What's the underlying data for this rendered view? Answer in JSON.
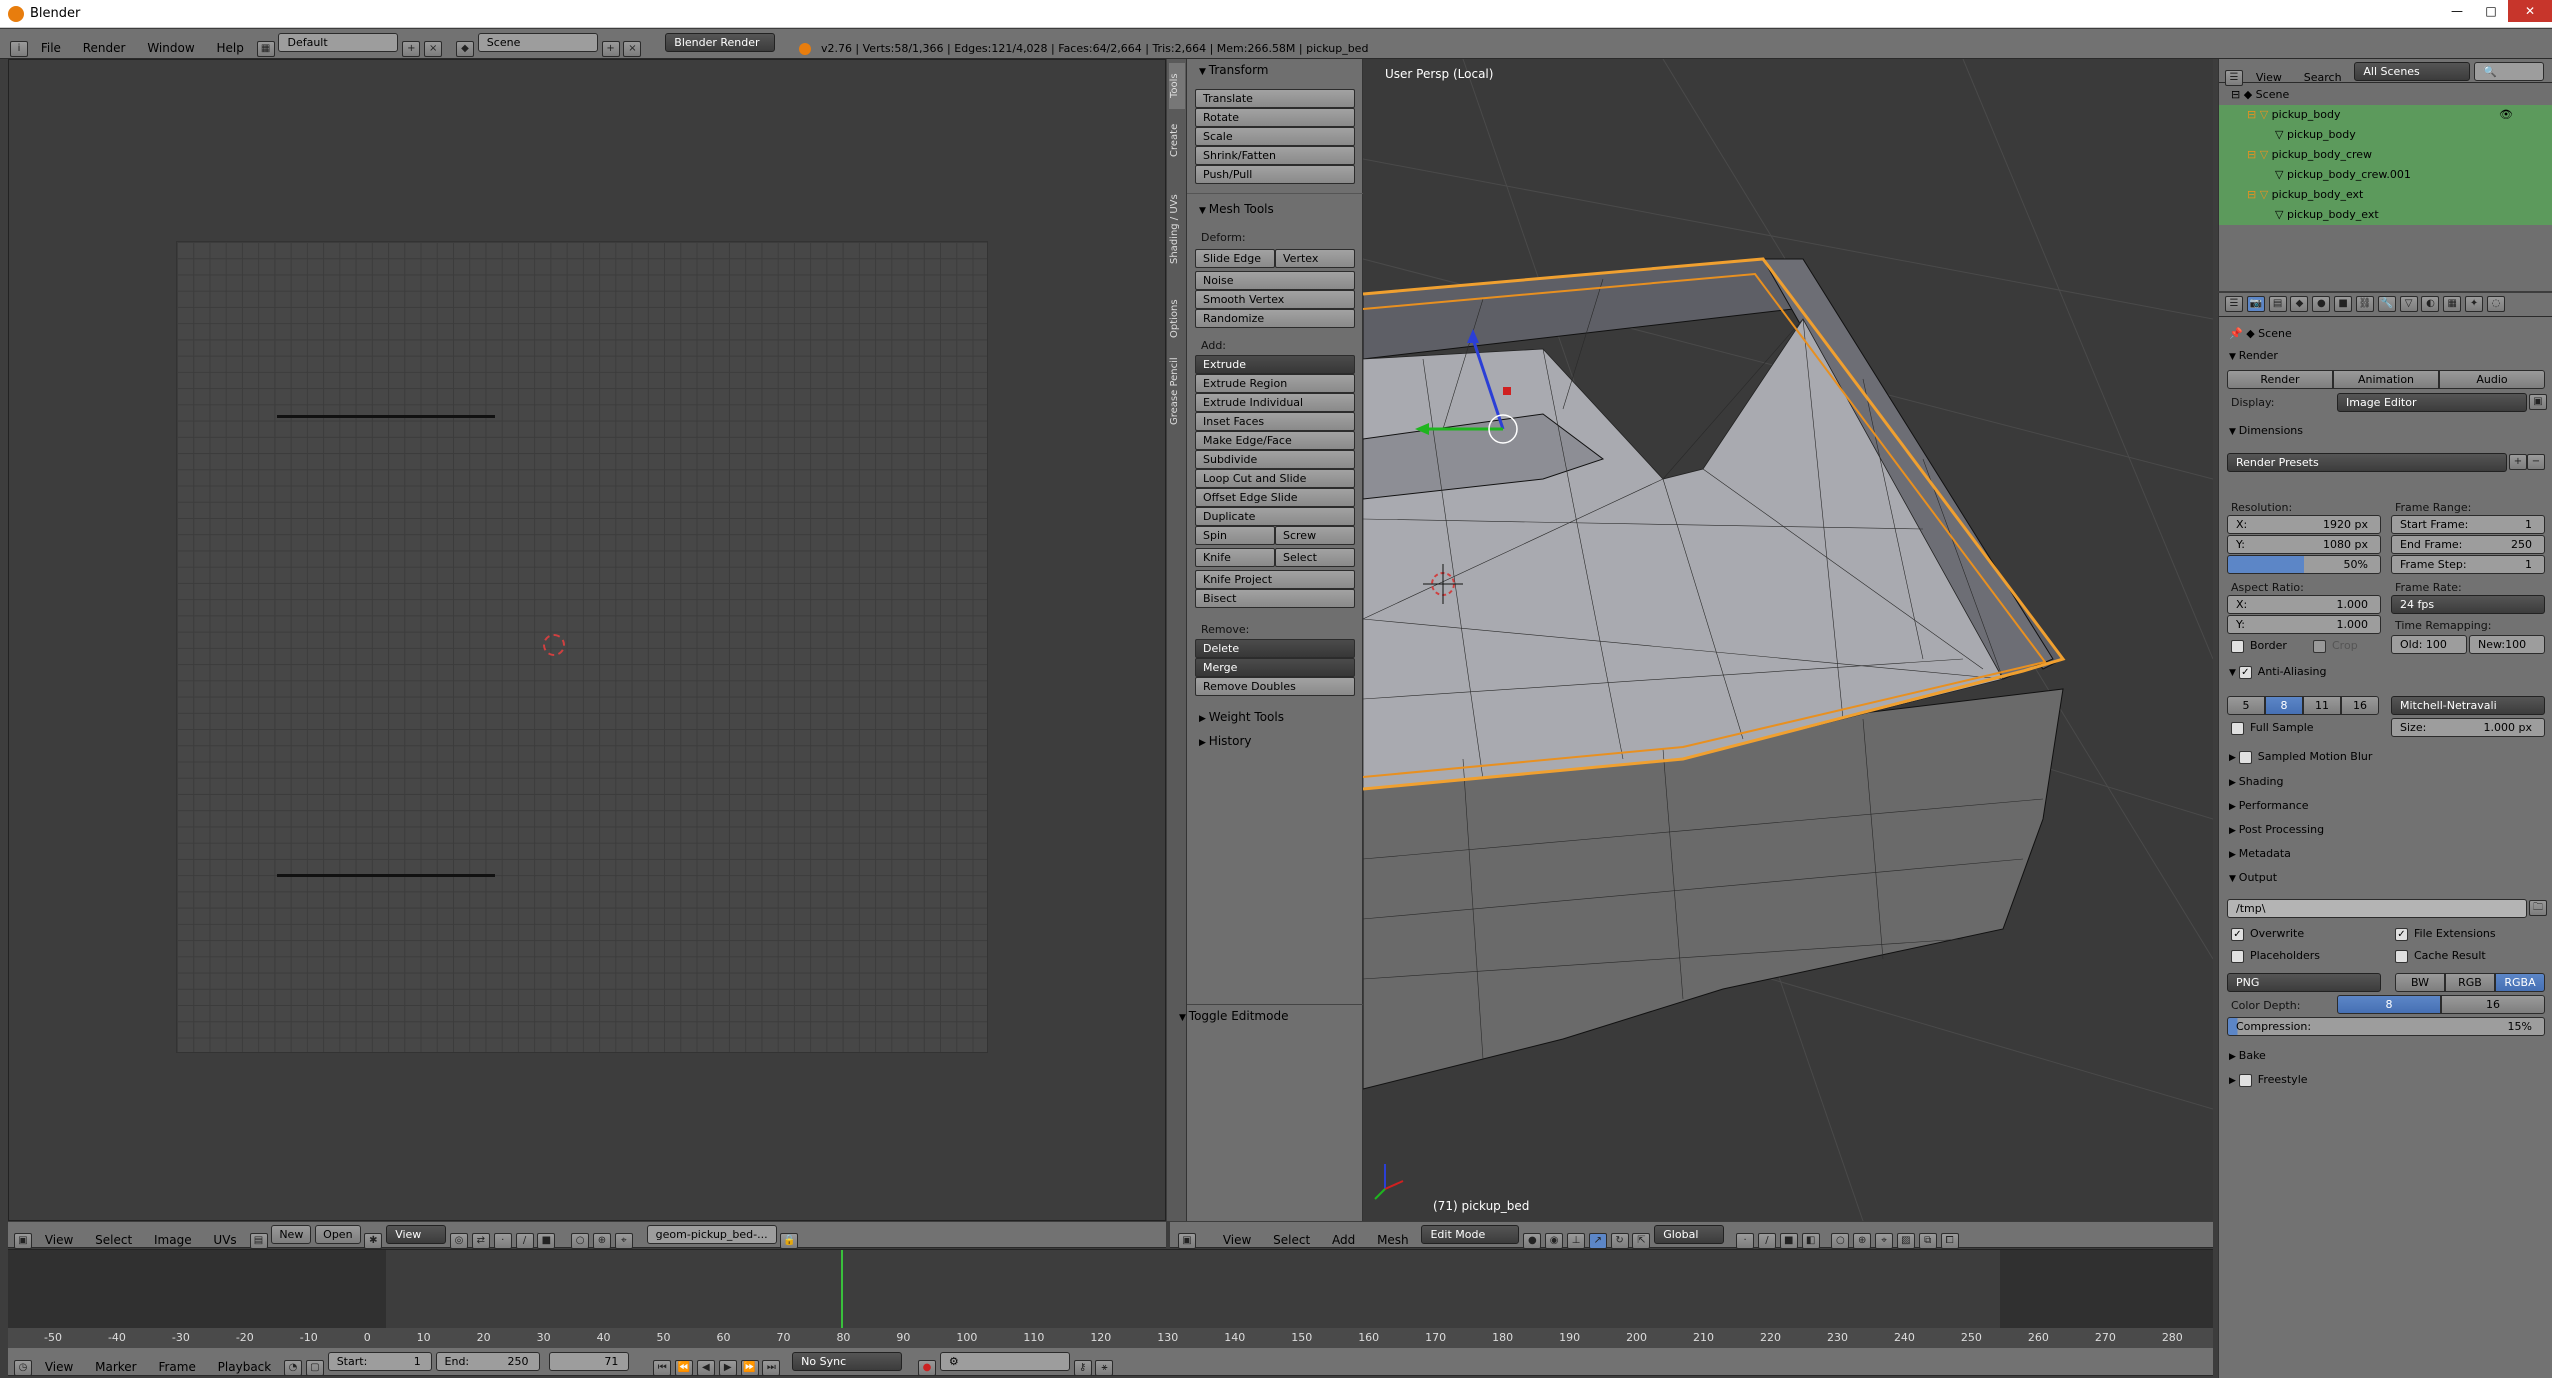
{
  "window": {
    "title": "Blender"
  },
  "topbar": {
    "menus": [
      "File",
      "Render",
      "Window",
      "Help"
    ],
    "layout": "Default",
    "scene": "Scene",
    "engine": "Blender Render",
    "stats": "v2.76 | Verts:58/1,366 | Edges:121/4,028 | Faces:64/2,664 | Tris:2,664 | Mem:266.58M | pickup_bed"
  },
  "image_editor": {
    "menus": [
      "View",
      "Select",
      "Image",
      "UVs"
    ],
    "new_label": "New",
    "open_label": "Open",
    "view_label": "View",
    "image_name": "geom-pickup_bed-..."
  },
  "toolshelf": {
    "tabs": [
      "Tools",
      "Create",
      "Shading / UVs",
      "Options",
      "Grease Pencil"
    ],
    "transform_header": "Transform",
    "transform": [
      "Translate",
      "Rotate",
      "Scale",
      "Shrink/Fatten",
      "Push/Pull"
    ],
    "mesh_tools_header": "Mesh Tools",
    "deform_label": "Deform:",
    "slide_edge": "Slide Edge",
    "vertex": "Vertex",
    "deform": [
      "Noise",
      "Smooth Vertex",
      "Randomize"
    ],
    "add_label": "Add:",
    "extrude": "Extrude",
    "add": [
      "Extrude Region",
      "Extrude Individual",
      "Inset Faces",
      "Make Edge/Face",
      "Subdivide",
      "Loop Cut and Slide",
      "Offset Edge Slide",
      "Duplicate"
    ],
    "spin": "Spin",
    "screw": "Screw",
    "knife": "Knife",
    "select": "Select",
    "knife_project": "Knife Project",
    "bisect": "Bisect",
    "remove_label": "Remove:",
    "delete": "Delete",
    "merge": "Merge",
    "remove_doubles": "Remove Doubles",
    "weight_tools": "Weight Tools",
    "history": "History",
    "toggle_editmode": "Toggle Editmode"
  },
  "viewport": {
    "label": "User Persp (Local)",
    "object_label": "(71) pickup_bed",
    "menus": [
      "View",
      "Select",
      "Add",
      "Mesh"
    ],
    "mode": "Edit Mode",
    "orientation": "Global"
  },
  "outliner": {
    "menus": [
      "View",
      "Search"
    ],
    "filter": "All Scenes",
    "search_placeholder": "",
    "items": [
      {
        "label": "Scene",
        "depth": 0
      },
      {
        "label": "pickup_body",
        "depth": 1
      },
      {
        "label": "pickup_body",
        "depth": 2
      },
      {
        "label": "pickup_body_crew",
        "depth": 1
      },
      {
        "label": "pickup_body_crew.001",
        "depth": 2
      },
      {
        "label": "pickup_body_ext",
        "depth": 1
      },
      {
        "label": "pickup_body_ext",
        "depth": 2
      }
    ]
  },
  "properties": {
    "scene_label": "Scene",
    "render_header": "Render",
    "render_btn": "Render",
    "animation_btn": "Animation",
    "audio_btn": "Audio",
    "display_label": "Display:",
    "display_value": "Image Editor",
    "dimensions_header": "Dimensions",
    "render_presets": "Render Presets",
    "resolution_label": "Resolution:",
    "res_x": "X:",
    "res_x_val": "1920 px",
    "res_y": "Y:",
    "res_y_val": "1080 px",
    "res_pct": "50%",
    "frame_range_label": "Frame Range:",
    "start_frame": "Start Frame:",
    "start_frame_val": "1",
    "end_frame": "End Frame:",
    "end_frame_val": "250",
    "frame_step": "Frame Step:",
    "frame_step_val": "1",
    "aspect_label": "Aspect Ratio:",
    "asp_x": "X:",
    "asp_x_val": "1.000",
    "asp_y": "Y:",
    "asp_y_val": "1.000",
    "frame_rate_label": "Frame Rate:",
    "fps": "24 fps",
    "time_remap_label": "Time Remapping:",
    "old_label": "Old: 100",
    "new_label": "New:100",
    "border": "Border",
    "crop": "Crop",
    "aa_header": "Anti-Aliasing",
    "aa_samples": [
      "5",
      "8",
      "11",
      "16"
    ],
    "aa_filter": "Mitchell-Netravali",
    "full_sample": "Full Sample",
    "size_label": "Size:",
    "size_val": "1.000 px",
    "collapsed": [
      "Sampled Motion Blur",
      "Shading",
      "Performance",
      "Post Processing",
      "Metadata"
    ],
    "output_header": "Output",
    "output_path": "/tmp\\",
    "overwrite": "Overwrite",
    "file_ext": "File Extensions",
    "placeholders": "Placeholders",
    "cache_result": "Cache Result",
    "format": "PNG",
    "bw": "BW",
    "rgb": "RGB",
    "rgba": "RGBA",
    "color_depth_label": "Color Depth:",
    "depth_8": "8",
    "depth_16": "16",
    "compression": "Compression:",
    "compression_val": "15%",
    "bake": "Bake",
    "freestyle": "Freestyle"
  },
  "timeline": {
    "ruler": [
      "-50",
      "-40",
      "-30",
      "-20",
      "-10",
      "0",
      "10",
      "20",
      "30",
      "40",
      "50",
      "60",
      "70",
      "80",
      "90",
      "100",
      "110",
      "120",
      "130",
      "140",
      "150",
      "160",
      "170",
      "180",
      "190",
      "200",
      "210",
      "220",
      "230",
      "240",
      "250",
      "260",
      "270",
      "280"
    ],
    "menus": [
      "View",
      "Marker",
      "Frame",
      "Playback"
    ],
    "start": "Start:",
    "start_val": "1",
    "end": "End:",
    "end_val": "250",
    "current": "71",
    "sync": "No Sync"
  }
}
